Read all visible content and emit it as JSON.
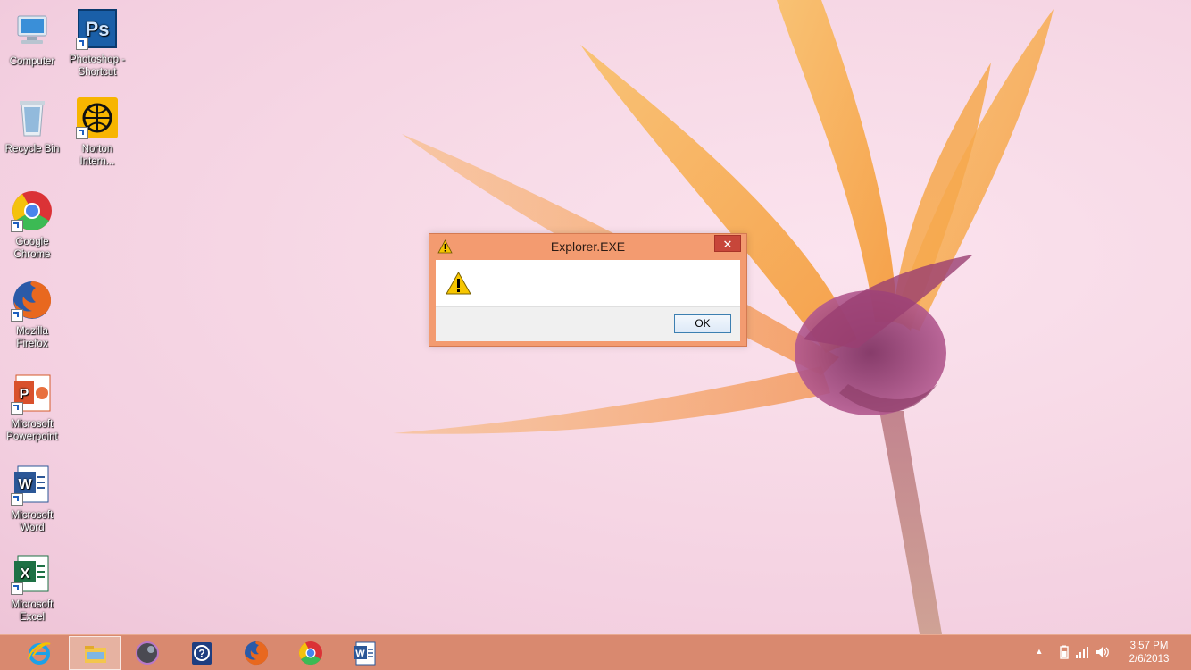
{
  "desktop": {
    "icons": [
      {
        "label": "Computer",
        "icon": "computer-icon"
      },
      {
        "label": "Photoshop - Shortcut",
        "icon": "photoshop-icon"
      },
      {
        "label": "Recycle Bin",
        "icon": "recycle-bin-icon"
      },
      {
        "label": "Norton Intern...",
        "icon": "norton-icon"
      },
      {
        "label": "Google Chrome",
        "icon": "chrome-icon"
      },
      {
        "label": "Mozilla Firefox",
        "icon": "firefox-icon"
      },
      {
        "label": "Microsoft Powerpoint",
        "icon": "powerpoint-icon"
      },
      {
        "label": "Microsoft Word",
        "icon": "word-icon"
      },
      {
        "label": "Microsoft Excel",
        "icon": "excel-icon"
      }
    ]
  },
  "dialog": {
    "title": "Explorer.EXE",
    "close_label": "✕",
    "ok_label": "OK",
    "icon": "warning-icon"
  },
  "taskbar": {
    "apps": [
      {
        "name": "internet-explorer",
        "icon": "ie-icon"
      },
      {
        "name": "file-explorer",
        "icon": "folder-icon",
        "active": true
      },
      {
        "name": "app-orb",
        "icon": "orb-icon"
      },
      {
        "name": "help",
        "icon": "help-icon"
      },
      {
        "name": "firefox",
        "icon": "firefox-icon"
      },
      {
        "name": "chrome",
        "icon": "chrome-icon"
      },
      {
        "name": "word",
        "icon": "word-icon"
      }
    ],
    "tray": {
      "chevron": "▲",
      "time": "3:57 PM",
      "date": "2/6/2013"
    }
  },
  "colors": {
    "taskbar": "#d9896f",
    "dialog_frame": "#f39b70",
    "close_button": "#c7463a"
  }
}
